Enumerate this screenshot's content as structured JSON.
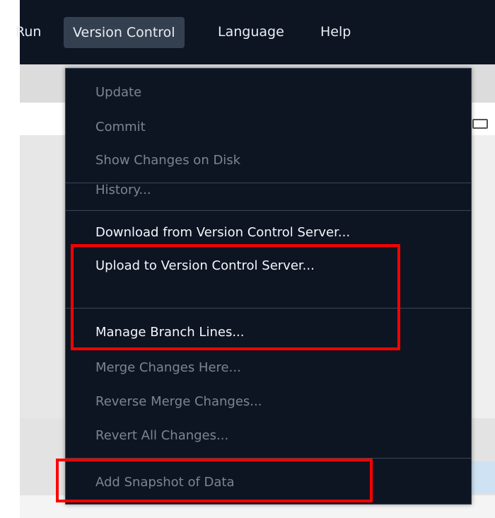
{
  "menubar": {
    "items": [
      {
        "label": "Run"
      },
      {
        "label": "Version Control"
      },
      {
        "label": "Language"
      },
      {
        "label": "Help"
      }
    ]
  },
  "dropdown": {
    "items": [
      {
        "label": "Update",
        "enabled": false
      },
      {
        "label": "Commit",
        "enabled": false
      },
      {
        "label": "Show Changes on Disk",
        "enabled": false
      },
      {
        "label": "History...",
        "enabled": false
      },
      {
        "label": "Download from Version Control Server...",
        "enabled": true
      },
      {
        "label": "Upload to Version Control Server...",
        "enabled": true
      },
      {
        "label": "Manage Branch Lines...",
        "enabled": true
      },
      {
        "label": "Merge Changes Here...",
        "enabled": false
      },
      {
        "label": "Reverse Merge Changes...",
        "enabled": false
      },
      {
        "label": "Revert All Changes...",
        "enabled": false
      },
      {
        "label": "Add Snapshot of Data",
        "enabled": false
      }
    ]
  },
  "colors": {
    "menu_bg": "#0d1523",
    "active_menu_bg": "#343f50",
    "enabled_text": "#f4f6fa",
    "disabled_text": "#7a8594",
    "highlight": "#ff0000"
  }
}
